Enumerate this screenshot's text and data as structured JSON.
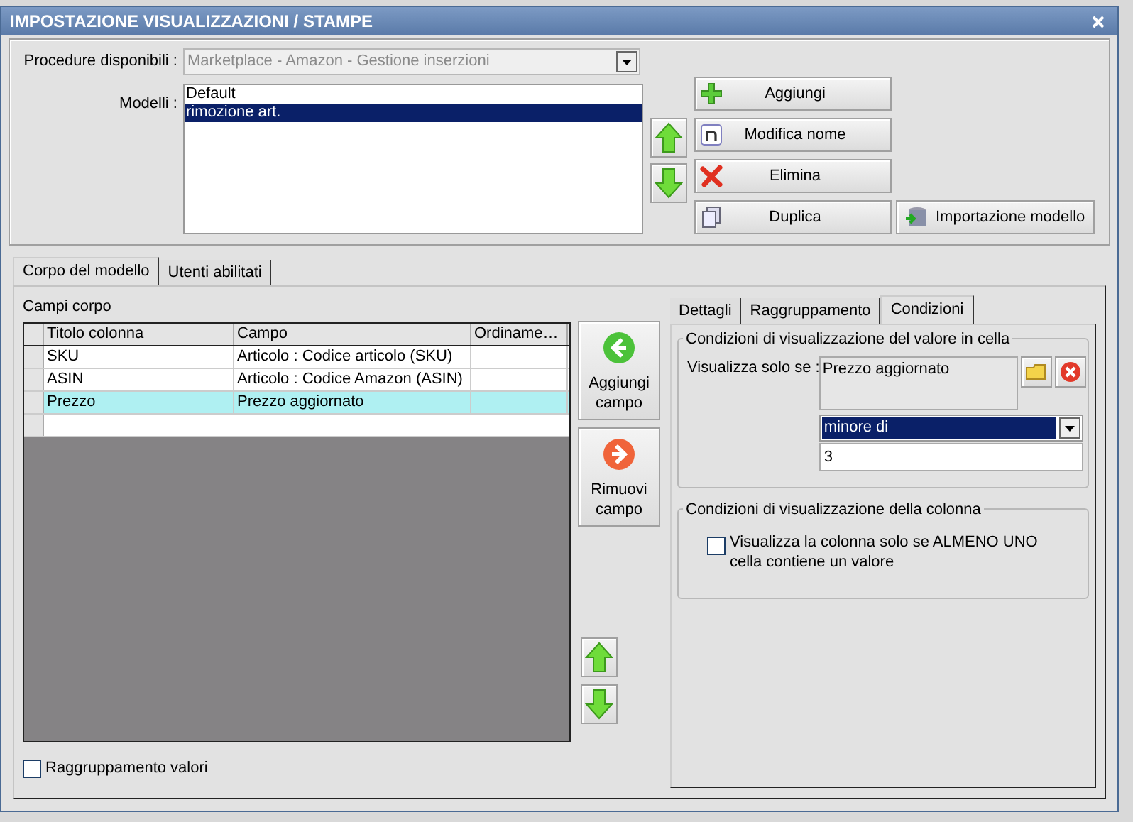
{
  "window": {
    "title": "IMPOSTAZIONE VISUALIZZAZIONI / STAMPE"
  },
  "procedure": {
    "label": "Procedure disponibili :",
    "value": "Marketplace - Amazon - Gestione inserzioni",
    "disabled": true
  },
  "models": {
    "label": "Modelli :",
    "items": [
      {
        "label": "Default",
        "selected": false
      },
      {
        "label": "rimozione art.",
        "selected": true
      }
    ]
  },
  "model_buttons": [
    {
      "kind": "add",
      "label": "Aggiungi"
    },
    {
      "kind": "rename",
      "label": "Modifica nome"
    },
    {
      "kind": "delete",
      "label": "Elimina"
    },
    {
      "kind": "duplicate",
      "label": "Duplica"
    },
    {
      "kind": "import",
      "label": "Importazione modello"
    }
  ],
  "tabs": [
    {
      "label": "Corpo del modello",
      "selected": true
    },
    {
      "label": "Utenti abilitati",
      "selected": false
    }
  ],
  "body_fields": {
    "title": "Campi corpo",
    "columns": [
      "Titolo colonna",
      "Campo",
      "Ordiname…"
    ],
    "rows": [
      {
        "cells": [
          "SKU",
          "Articolo : Codice articolo (SKU)",
          ""
        ],
        "selected": false
      },
      {
        "cells": [
          "ASIN",
          "Articolo : Codice Amazon (ASIN)",
          ""
        ],
        "selected": false
      },
      {
        "cells": [
          "Prezzo",
          "Prezzo aggiornato",
          ""
        ],
        "selected": true
      }
    ]
  },
  "field_buttons": [
    {
      "kind": "add",
      "label": "Aggiungi campo"
    },
    {
      "kind": "remove",
      "label": "Rimuovi campo"
    }
  ],
  "detail_tabs": [
    {
      "label": "Dettagli",
      "selected": false
    },
    {
      "label": "Raggruppamento",
      "selected": false
    },
    {
      "label": "Condizioni",
      "selected": true
    }
  ],
  "cell_conditions": {
    "title": "Condizioni di visualizzazione del valore in cella",
    "label": "Visualizza solo se :",
    "field": "Prezzo aggiornato",
    "operator": "minore di",
    "value": "3"
  },
  "column_conditions": {
    "title": "Condizioni di visualizzazione della colonna",
    "checkbox": {
      "label": "Visualizza la colonna solo se ALMENO UNO cella contiene un valore",
      "checked": false
    }
  },
  "grouping": {
    "label": "Raggruppamento valori",
    "checked": false
  }
}
